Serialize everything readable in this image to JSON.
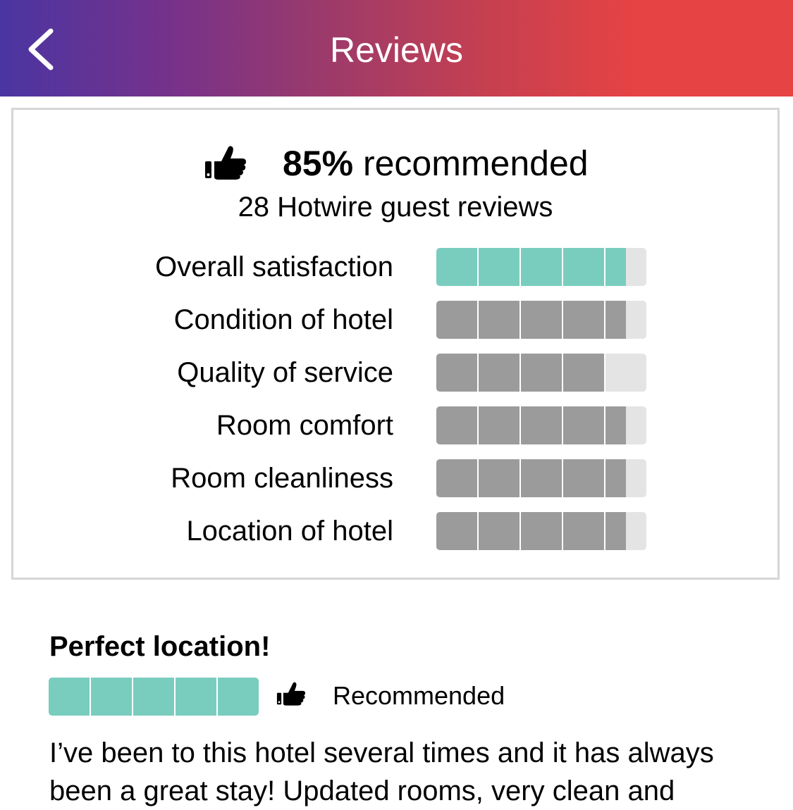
{
  "header": {
    "title": "Reviews",
    "back_icon": "chevron-left-icon",
    "gradient_colors": [
      "#4a35a2",
      "#9a3a6c",
      "#e54344"
    ]
  },
  "summary": {
    "recommended_percent": "85%",
    "recommended_suffix": " recommended",
    "review_count_text": "28 Hotwire guest reviews",
    "icon": "thumbs-up-icon",
    "segments_per_bar": 5,
    "ratings": [
      {
        "label": "Overall satisfaction",
        "value": 4.5,
        "color": "#79cdbf"
      },
      {
        "label": "Condition of hotel",
        "value": 4.5,
        "color": "#9b9b9b"
      },
      {
        "label": "Quality of service",
        "value": 4.0,
        "color": "#9b9b9b"
      },
      {
        "label": "Room comfort",
        "value": 4.5,
        "color": "#9b9b9b"
      },
      {
        "label": "Room cleanliness",
        "value": 4.5,
        "color": "#9b9b9b"
      },
      {
        "label": "Location of hotel",
        "value": 4.5,
        "color": "#9b9b9b"
      }
    ]
  },
  "review": {
    "title": "Perfect location!",
    "rating": 5,
    "rating_color": "#79cdbf",
    "recommended_label": "Recommended",
    "body": "I’ve been to this hotel several times and it has always been a great stay! Updated rooms, very clean and"
  }
}
